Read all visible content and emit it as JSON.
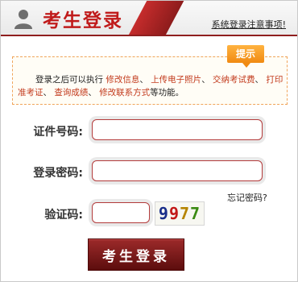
{
  "header": {
    "title": "考生登录",
    "notice_link": "系统登录注意事项!"
  },
  "tip": {
    "tag": "提示",
    "lead": "登录之后可以执行",
    "links": [
      "修改信息",
      "上传电子照片",
      "交纳考试费",
      "打印准考证",
      "查询成绩",
      "修改联系方式"
    ],
    "separator": "、",
    "tail": "等功能。"
  },
  "form": {
    "id_label": "证件号码:",
    "id_value": "",
    "password_label": "登录密码:",
    "password_value": "",
    "captcha_label": "验证码:",
    "captcha_value": "",
    "captcha_code": "9977",
    "forgot": "忘记密码?",
    "submit": "考生登录"
  },
  "colors": {
    "brand_red": "#c01b1b",
    "link_orange": "#c2391b",
    "tip_tag": "#f08a12",
    "captcha_digits": [
      "#1a2f8a",
      "#c21818",
      "#b58400",
      "#3a8a12"
    ]
  },
  "icons": {
    "avatar": "user-silhouette-icon"
  }
}
